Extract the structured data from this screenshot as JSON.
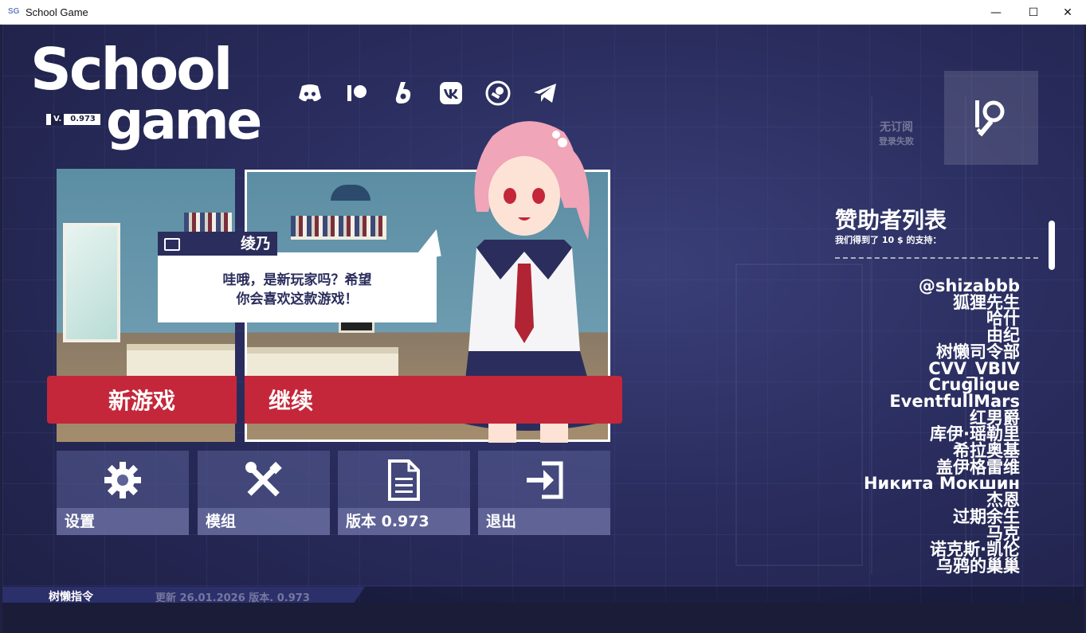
{
  "window": {
    "app_icon": "SG",
    "title": "School Game",
    "minimize": "—",
    "maximize": "☐",
    "close": "✕"
  },
  "logo": {
    "line1": "School",
    "line2": "game",
    "version_prefix": "V.",
    "version": "0.973"
  },
  "socials": [
    "discord-icon",
    "patreon-icon",
    "boosty-icon",
    "vk-icon",
    "steam-icon",
    "telegram-icon"
  ],
  "login": {
    "status_line1": "无订阅",
    "status_line2": "登录失败"
  },
  "dialog": {
    "speaker": "绫乃",
    "line1": "哇哦，是新玩家吗？希望",
    "line2": "你会喜欢这款游戏！"
  },
  "buttons": {
    "new_game": "新游戏",
    "continue": "继续"
  },
  "tiles": [
    {
      "label": "设置",
      "icon": "gear-icon"
    },
    {
      "label": "模组",
      "icon": "tools-icon"
    },
    {
      "label": "版本 0.973",
      "icon": "document-icon"
    },
    {
      "label": "退出",
      "icon": "exit-icon"
    }
  ],
  "sponsors": {
    "title": "赞助者列表",
    "subtitle": "我们得到了 10 $ 的支持：",
    "list": [
      "@shizabbb",
      "狐狸先生",
      "哈什",
      "由纪",
      "树懒司令部",
      "CVV_VBIV",
      "Cruglique",
      "EventfullMars",
      "红男爵",
      "库伊·瑶勒里",
      "希拉奥基",
      "盖伊格雷维",
      "Никита Мокшин",
      "杰恩",
      "过期余生",
      "马克",
      "诺克斯·凯伦",
      "乌鸦的巢巢"
    ]
  },
  "footer": {
    "command": "树懒指令",
    "update": "更新 26.01.2026 版本. 0.973"
  },
  "colors": {
    "accent_red": "#c4273a",
    "navy": "#2b2d5c",
    "background": "#2a2d5e"
  }
}
